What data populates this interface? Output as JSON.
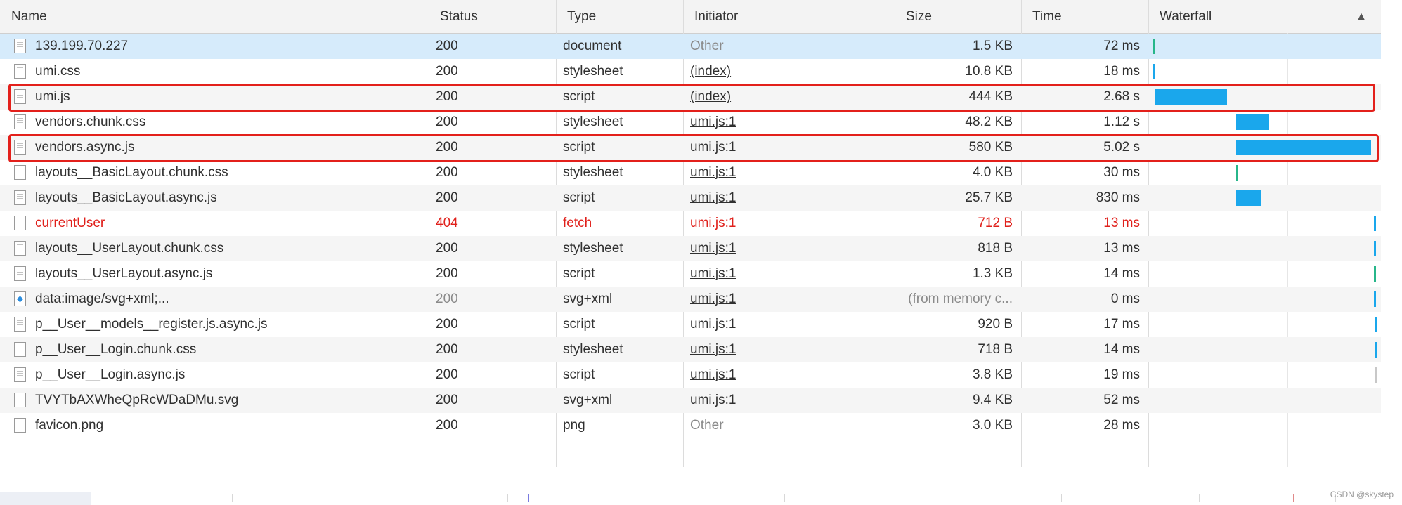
{
  "columns": {
    "name": "Name",
    "status": "Status",
    "type": "Type",
    "initiator": "Initiator",
    "size": "Size",
    "time": "Time",
    "waterfall": "Waterfall"
  },
  "sort_indicator": "▲",
  "rows": [
    {
      "name": "139.199.70.227",
      "status": "200",
      "type": "document",
      "initiator": "Other",
      "size": "1.5 KB",
      "time": "72 ms",
      "icon": "document-icon"
    },
    {
      "name": "umi.css",
      "status": "200",
      "type": "stylesheet",
      "initiator": "(index)",
      "size": "10.8 KB",
      "time": "18 ms",
      "icon": "document-icon"
    },
    {
      "name": "umi.js",
      "status": "200",
      "type": "script",
      "initiator": "(index)",
      "size": "444 KB",
      "time": "2.68 s",
      "icon": "document-icon",
      "highlighted": true
    },
    {
      "name": "vendors.chunk.css",
      "status": "200",
      "type": "stylesheet",
      "initiator": "umi.js:1",
      "size": "48.2 KB",
      "time": "1.12 s",
      "icon": "document-icon"
    },
    {
      "name": "vendors.async.js",
      "status": "200",
      "type": "script",
      "initiator": "umi.js:1",
      "size": "580 KB",
      "time": "5.02 s",
      "icon": "document-icon",
      "highlighted": true
    },
    {
      "name": "layouts__BasicLayout.chunk.css",
      "status": "200",
      "type": "stylesheet",
      "initiator": "umi.js:1",
      "size": "4.0 KB",
      "time": "30 ms",
      "icon": "document-icon"
    },
    {
      "name": "layouts__BasicLayout.async.js",
      "status": "200",
      "type": "script",
      "initiator": "umi.js:1",
      "size": "25.7 KB",
      "time": "830 ms",
      "icon": "document-icon"
    },
    {
      "name": "currentUser",
      "status": "404",
      "type": "fetch",
      "initiator": "umi.js:1",
      "size": "712 B",
      "time": "13 ms",
      "icon": "blank-file-icon",
      "error": true
    },
    {
      "name": "layouts__UserLayout.chunk.css",
      "status": "200",
      "type": "stylesheet",
      "initiator": "umi.js:1",
      "size": "818 B",
      "time": "13 ms",
      "icon": "document-icon"
    },
    {
      "name": "layouts__UserLayout.async.js",
      "status": "200",
      "type": "script",
      "initiator": "umi.js:1",
      "size": "1.3 KB",
      "time": "14 ms",
      "icon": "document-icon"
    },
    {
      "name": "data:image/svg+xml;...",
      "status": "200",
      "type": "svg+xml",
      "initiator": "umi.js:1",
      "size": "(from memory c...",
      "time": "0 ms",
      "icon": "image-icon",
      "dim_status": true,
      "dim_size": true
    },
    {
      "name": "p__User__models__register.js.async.js",
      "status": "200",
      "type": "script",
      "initiator": "umi.js:1",
      "size": "920 B",
      "time": "17 ms",
      "icon": "document-icon"
    },
    {
      "name": "p__User__Login.chunk.css",
      "status": "200",
      "type": "stylesheet",
      "initiator": "umi.js:1",
      "size": "718 B",
      "time": "14 ms",
      "icon": "document-icon"
    },
    {
      "name": "p__User__Login.async.js",
      "status": "200",
      "type": "script",
      "initiator": "umi.js:1",
      "size": "3.8 KB",
      "time": "19 ms",
      "icon": "document-icon"
    },
    {
      "name": "TVYTbAXWheQpRcWDaDMu.svg",
      "status": "200",
      "type": "svg+xml",
      "initiator": "umi.js:1",
      "size": "9.4 KB",
      "time": "52 ms",
      "icon": "blank-file-icon"
    },
    {
      "name": "favicon.png",
      "status": "200",
      "type": "png",
      "initiator": "Other",
      "size": "3.0 KB",
      "time": "28 ms",
      "icon": "blank-file-icon"
    }
  ],
  "waterfall_bars": [
    {
      "start": 0.02,
      "duration": 0.012,
      "color": "#27b68a"
    },
    {
      "start": 0.02,
      "duration": 0.01,
      "color": "#1aa7ec"
    },
    {
      "start": 0.03,
      "duration": 0.53,
      "color": "#1aa7ec"
    },
    {
      "start": 0.63,
      "duration": 0.24,
      "color": "#1aa7ec"
    },
    {
      "start": 0.63,
      "duration": 0.99,
      "color": "#1aa7ec"
    },
    {
      "start": 0.63,
      "duration": 0.015,
      "color": "#27b68a"
    },
    {
      "start": 0.63,
      "duration": 0.18,
      "color": "#1aa7ec"
    },
    {
      "start": 1.64,
      "duration": 0.01,
      "color": "#1aa7ec"
    },
    {
      "start": 1.64,
      "duration": 0.012,
      "color": "#1aa7ec"
    },
    {
      "start": 1.64,
      "duration": 0.012,
      "color": "#27b68a"
    },
    {
      "start": 1.64,
      "duration": 0.008,
      "color": "#1aa7ec"
    },
    {
      "start": 1.65,
      "duration": 0.008,
      "color": "#1aa7ec"
    },
    {
      "start": 1.65,
      "duration": 0.008,
      "color": "#1aa7ec"
    },
    {
      "start": 1.65,
      "duration": 0.006,
      "color": "#c8c8c8"
    }
  ],
  "colors": {
    "selected_row": "#d6ebfb",
    "error_text": "#e0201b",
    "highlight_border": "#e3201b",
    "bar_blue": "#1aa7ec",
    "bar_green": "#27b68a"
  },
  "watermark": "CSDN @skystep"
}
